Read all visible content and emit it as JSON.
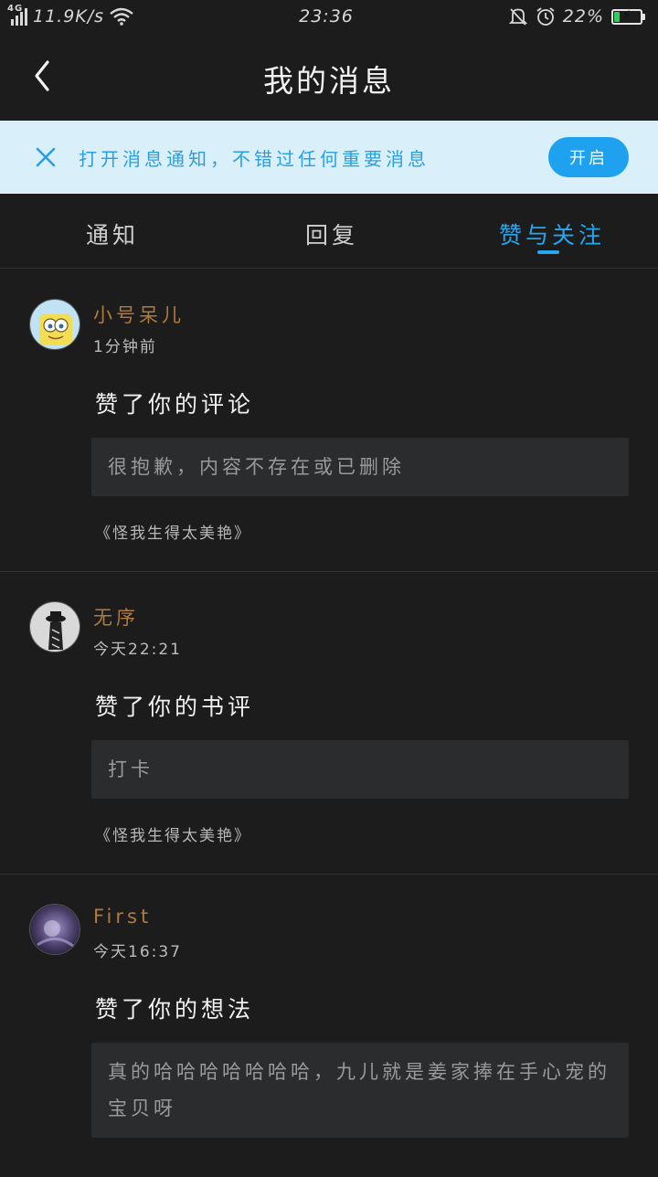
{
  "status_bar": {
    "network_type": "4G",
    "speed": "11.9K/s",
    "time": "23:36",
    "battery": "22%",
    "battery_level": 0.22,
    "icons": [
      "signal-icon",
      "wifi-icon",
      "mute-bell-icon",
      "alarm-icon",
      "battery-icon"
    ]
  },
  "header": {
    "title": "我的消息"
  },
  "notice": {
    "text": "打开消息通知，不错过任何重要消息",
    "button_label": "开启",
    "accent": "#1ea2f0",
    "background": "#d9f0fb"
  },
  "tabs": [
    {
      "label": "通知",
      "active": false
    },
    {
      "label": "回复",
      "active": false
    },
    {
      "label": "赞与关注",
      "active": true
    }
  ],
  "items": [
    {
      "username": "小号呆儿",
      "time": "1分钟前",
      "action": "赞了你的评论",
      "quote": "很抱歉，内容不存在或已删除",
      "source": "《怪我生得太美艳》"
    },
    {
      "username": "无序",
      "time": "今天22:21",
      "action": "赞了你的书评",
      "quote": "打卡",
      "source": "《怪我生得太美艳》"
    },
    {
      "username": "First",
      "time": "今天16:37",
      "action": "赞了你的想法",
      "quote": "真的哈哈哈哈哈哈哈，九儿就是姜家捧在手心宠的宝贝呀"
    }
  ]
}
